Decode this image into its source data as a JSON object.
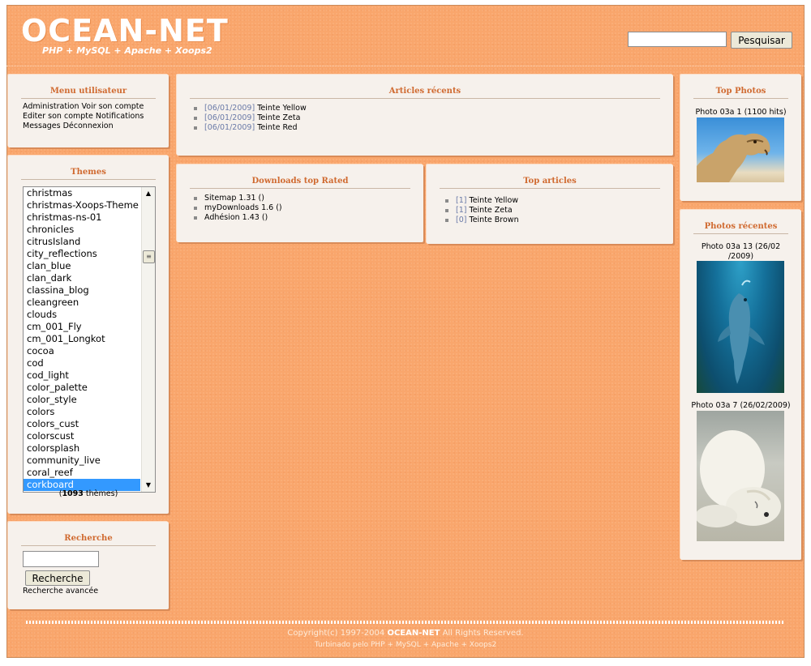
{
  "header": {
    "logo": "OCEAN-NET",
    "slogan": "PHP + MySQL + Apache + Xoops2",
    "search_button": "Pesquisar"
  },
  "user_menu": {
    "title": "Menu utilisateur",
    "lines": [
      "Administration Voir son compte",
      "Editer son compte Notifications",
      "Messages Déconnexion"
    ]
  },
  "themes": {
    "title": "Themes",
    "items": [
      "christmas",
      "christmas-Xoops-Theme",
      "christmas-ns-01",
      "chronicles",
      "citrusIsland",
      "city_reflections",
      "clan_blue",
      "clan_dark",
      "classina_blog",
      "cleangreen",
      "clouds",
      "cm_001_Fly",
      "cm_001_Longkot",
      "cocoa",
      "cod",
      "cod_light",
      "color_palette",
      "color_style",
      "colors",
      "colors_cust",
      "colorscust",
      "colorsplash",
      "community_live",
      "coral_reef",
      "corkboard"
    ],
    "selected": "corkboard",
    "count": "1093",
    "count_suffix": "thèmes"
  },
  "search_block": {
    "title": "Recherche",
    "button": "Recherche",
    "advanced": "Recherche avancée"
  },
  "recent_articles": {
    "title": "Articles récents",
    "items": [
      {
        "date": "[06/01/2009]",
        "name": "Teinte Yellow"
      },
      {
        "date": "[06/01/2009]",
        "name": "Teinte Zeta"
      },
      {
        "date": "[06/01/2009]",
        "name": "Teinte Red"
      }
    ]
  },
  "downloads": {
    "title": "Downloads top Rated",
    "items": [
      "Sitemap 1.31 ()",
      "myDownloads 1.6 ()",
      "Adhésion 1.43 ()"
    ]
  },
  "top_articles": {
    "title": "Top articles",
    "items": [
      {
        "count": "[1]",
        "name": "Teinte Yellow"
      },
      {
        "count": "[1]",
        "name": "Teinte Zeta"
      },
      {
        "count": "[0]",
        "name": "Teinte Brown"
      }
    ]
  },
  "top_photos": {
    "title": "Top Photos",
    "caption": "Photo 03a 1 (1100 hits)"
  },
  "recent_photos": {
    "title": "Photos récentes",
    "photo1_caption_l1": "Photo 03a 13 (26/02",
    "photo1_caption_l2": "/2009)",
    "photo2_caption": "Photo 03a 7 (26/02/2009)"
  },
  "footer": {
    "copyright_pre": "Copyright(c) 1997-2004",
    "copyright_brand": "OCEAN-NET",
    "copyright_post": "All Rights Reserved.",
    "powered": "Turbinado pelo PHP + MySQL + Apache + Xoops2"
  },
  "colors": {
    "background": "#f9a66c",
    "block": "#f6f1ec",
    "block_title": "#d06a30",
    "selected": "#3399ff"
  }
}
